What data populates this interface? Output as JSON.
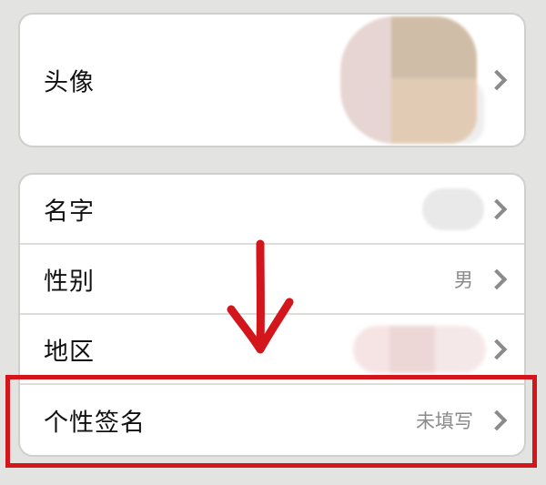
{
  "avatar_card": {
    "label": "头像",
    "avatar_image": "blurred-avatar"
  },
  "info_card": {
    "rows": [
      {
        "label": "名字",
        "value": ""
      },
      {
        "label": "性别",
        "value": "男"
      },
      {
        "label": "地区",
        "value": ""
      },
      {
        "label": "个性签名",
        "value": "未填写"
      }
    ]
  },
  "annotation": {
    "arrow_color": "#d3161b",
    "highlight_color": "#d3161b"
  },
  "colors": {
    "background": "#e3e3e1",
    "card": "#ffffff",
    "chevron": "#8b8b8b",
    "secondary_text": "#8a8a8a"
  }
}
